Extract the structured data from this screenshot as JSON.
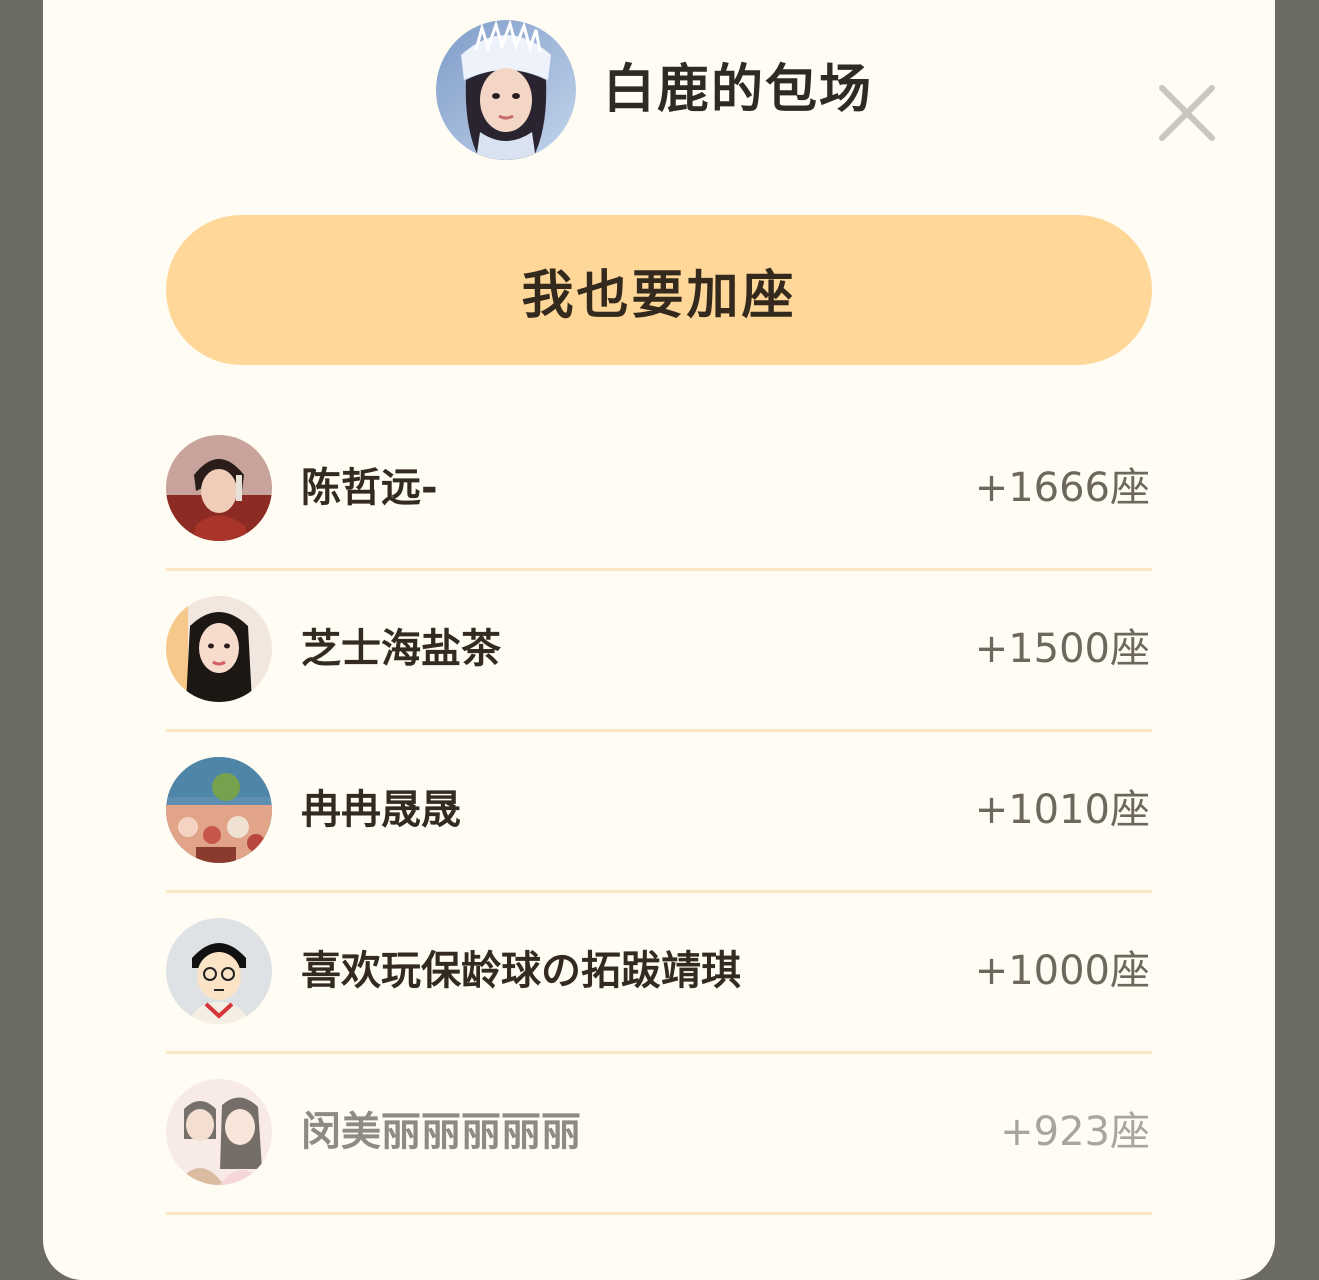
{
  "header": {
    "title": "白鹿的包场",
    "host_avatar_icon": "host-avatar"
  },
  "actions": {
    "join_label": "我也要加座",
    "close_icon": "close-icon"
  },
  "supporters": [
    {
      "name": "陈哲远-",
      "seats": "+1666座"
    },
    {
      "name": "芝士海盐茶",
      "seats": "+1500座"
    },
    {
      "name": "冉冉晟晟",
      "seats": "+1010座"
    },
    {
      "name": "喜欢玩保龄球の拓跋靖琪",
      "seats": "+1000座"
    },
    {
      "name": "闵美丽丽丽丽丽",
      "seats": "+923座"
    }
  ],
  "colors": {
    "sheet_background": "#fffdf3",
    "button_background": "#fed799",
    "divider": "#fbe7c4",
    "backdrop": "#6b6b64"
  }
}
